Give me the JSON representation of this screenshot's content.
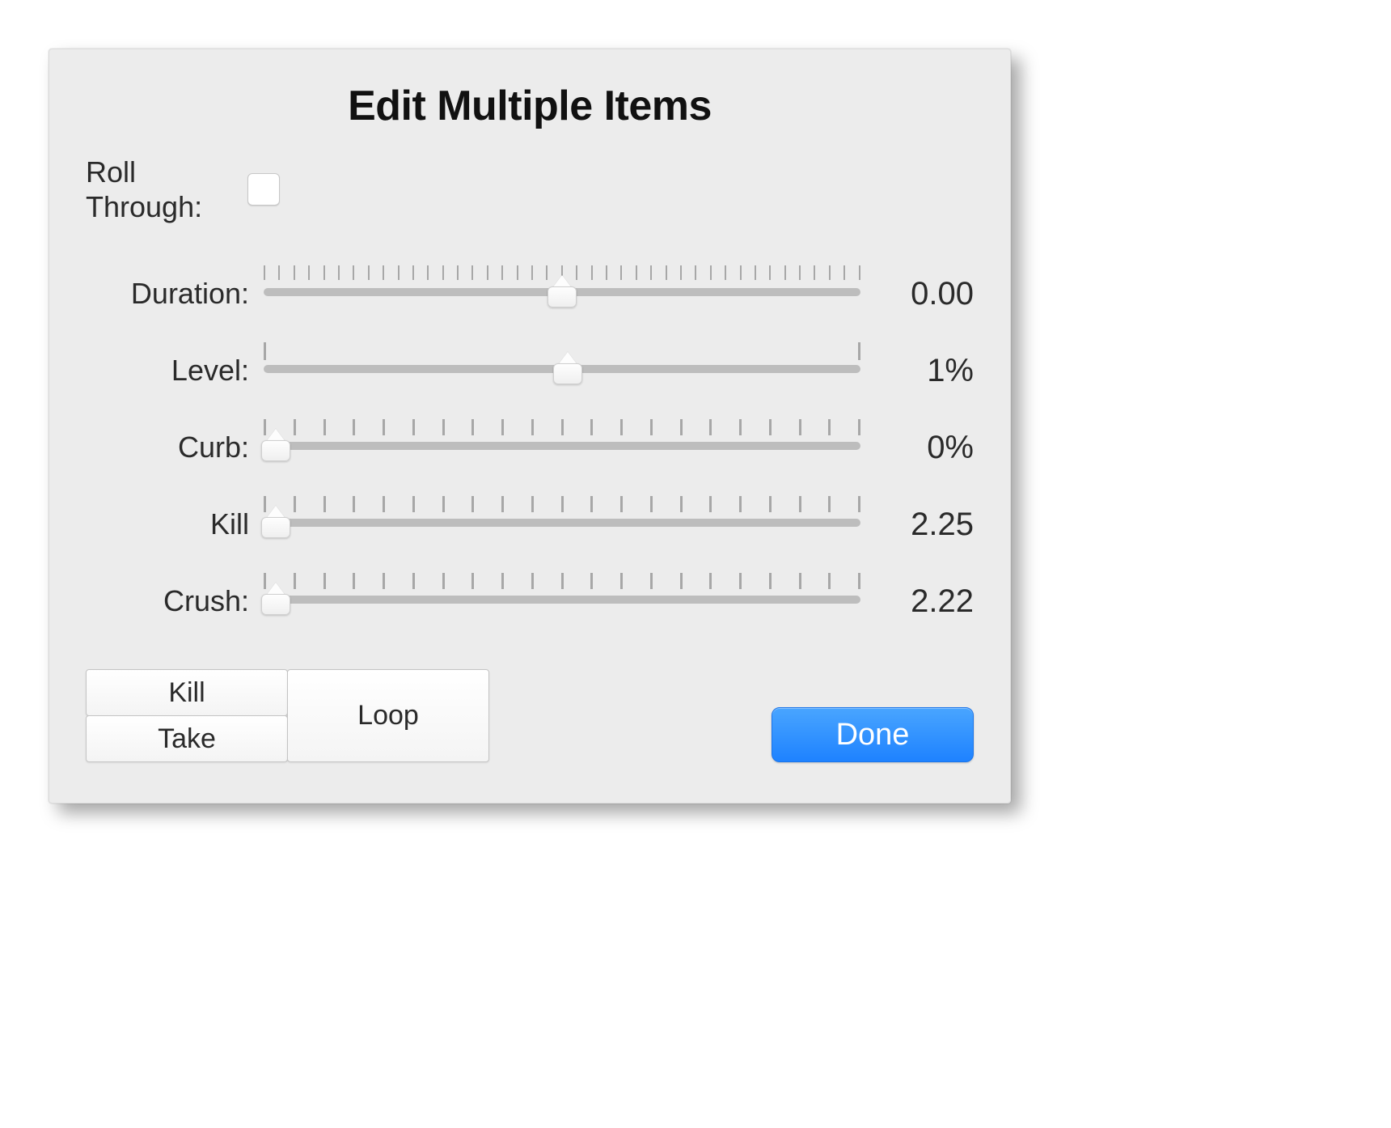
{
  "title": "Edit Multiple Items",
  "roll_through": {
    "label_line1": "Roll",
    "label_line2": "Through:",
    "checked": false
  },
  "sliders": {
    "duration": {
      "label": "Duration:",
      "value_text": "0.00",
      "position_pct": 50,
      "tick_style": "fine",
      "tick_count": 41
    },
    "level": {
      "label": "Level:",
      "value_text": "1%",
      "position_pct": 51,
      "tick_style": "two",
      "tick_count": 2
    },
    "curb": {
      "label": "Curb:",
      "value_text": "0%",
      "position_pct": 2,
      "tick_style": "coarse",
      "tick_count": 21
    },
    "kill": {
      "label": "Kill",
      "value_text": "2.25",
      "position_pct": 2,
      "tick_style": "coarse",
      "tick_count": 21
    },
    "crush": {
      "label": "Crush:",
      "value_text": "2.22",
      "position_pct": 2,
      "tick_style": "coarse",
      "tick_count": 21
    }
  },
  "buttons": {
    "kill": "Kill",
    "take": "Take",
    "loop": "Loop",
    "done": "Done"
  }
}
